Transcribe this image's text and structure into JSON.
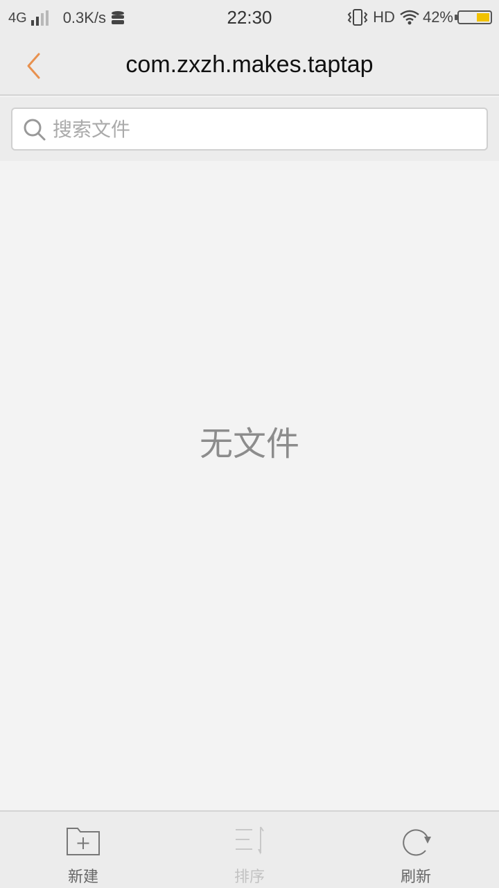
{
  "status_bar": {
    "network": "4G",
    "speed": "0.3K/s",
    "time": "22:30",
    "hd": "HD",
    "battery_percent": "42%",
    "battery_level": 0.42,
    "battery_color": "#f2c200",
    "icons": [
      "signal-icon",
      "data-icon",
      "vibrate-icon",
      "wifi-icon",
      "battery-icon"
    ]
  },
  "header": {
    "title": "com.zxzh.makes.taptap",
    "back_icon": "chevron-left-icon",
    "accent": "#e8914f"
  },
  "search": {
    "placeholder": "搜索文件",
    "value": ""
  },
  "main": {
    "empty_text": "无文件"
  },
  "bottom_bar": {
    "items": [
      {
        "label": "新建",
        "icon": "new-folder-icon",
        "enabled": true
      },
      {
        "label": "排序",
        "icon": "sort-icon",
        "enabled": false
      },
      {
        "label": "刷新",
        "icon": "refresh-icon",
        "enabled": true
      }
    ]
  }
}
